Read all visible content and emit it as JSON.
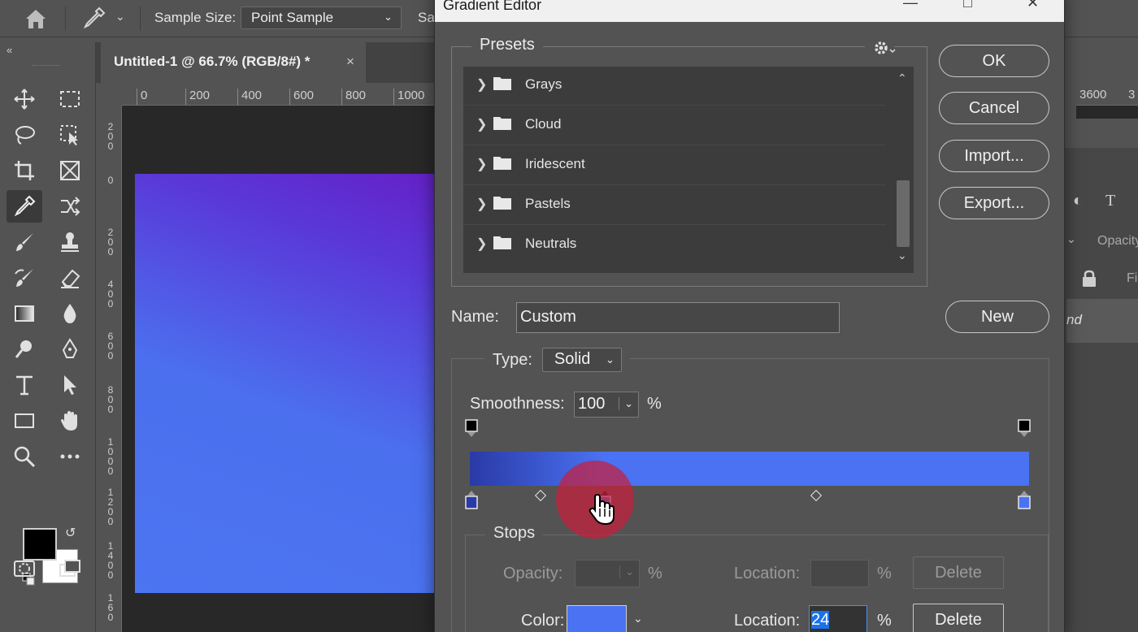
{
  "options_bar": {
    "sample_size_label": "Sample Size:",
    "sample_size_value": "Point Sample",
    "sample_label_truncated": "Sa"
  },
  "document": {
    "tab_title": "Untitled-1 @ 66.7% (RGB/8#) *",
    "tab_close": "×",
    "ruler_top": [
      "0",
      "200",
      "400",
      "600",
      "800",
      "1000"
    ],
    "ruler_left": [
      {
        "chars": [
          "2",
          "0",
          "0"
        ]
      },
      {
        "chars": [
          "0"
        ]
      },
      {
        "chars": [
          "2",
          "0",
          "0"
        ]
      },
      {
        "chars": [
          "4",
          "0",
          "0"
        ]
      },
      {
        "chars": [
          "6",
          "0",
          "0"
        ]
      },
      {
        "chars": [
          "8",
          "0",
          "0"
        ]
      },
      {
        "chars": [
          "1",
          "0",
          "0",
          "0"
        ]
      },
      {
        "chars": [
          "1",
          "2",
          "0",
          "0"
        ]
      },
      {
        "chars": [
          "1",
          "4",
          "0",
          "0"
        ]
      },
      {
        "chars": [
          "1",
          "6",
          "0"
        ]
      }
    ]
  },
  "right_panels": {
    "ruler_value": "3600",
    "ruler_value_truncated": "3",
    "opacity_label": "Opacity",
    "fill_label": "Fil",
    "layer_name_partial": "nd"
  },
  "dialog": {
    "title": "Gradient Editor",
    "presets_label": "Presets",
    "preset_folders": [
      "Grays",
      "Cloud",
      "Iridescent",
      "Pastels",
      "Neutrals"
    ],
    "buttons": {
      "ok": "OK",
      "cancel": "Cancel",
      "import": "Import...",
      "export": "Export...",
      "new": "New"
    },
    "name_label": "Name:",
    "name_value": "Custom",
    "type_label": "Type:",
    "type_value": "Solid",
    "smoothness_label": "Smoothness:",
    "smoothness_value": "100",
    "smoothness_unit": "%",
    "gradient": {
      "start_color": "#2a3aa6",
      "end_color": "#4a72f2",
      "selected_stop_location": 24
    },
    "stops": {
      "label": "Stops",
      "opacity_label": "Opacity:",
      "opacity_unit": "%",
      "opacity_location_label": "Location:",
      "opacity_location_unit": "%",
      "opacity_delete": "Delete",
      "color_label": "Color:",
      "color_value": "#4a72f2",
      "color_location_label": "Location:",
      "color_location_value": "24",
      "color_location_unit": "%",
      "color_delete": "Delete"
    }
  }
}
